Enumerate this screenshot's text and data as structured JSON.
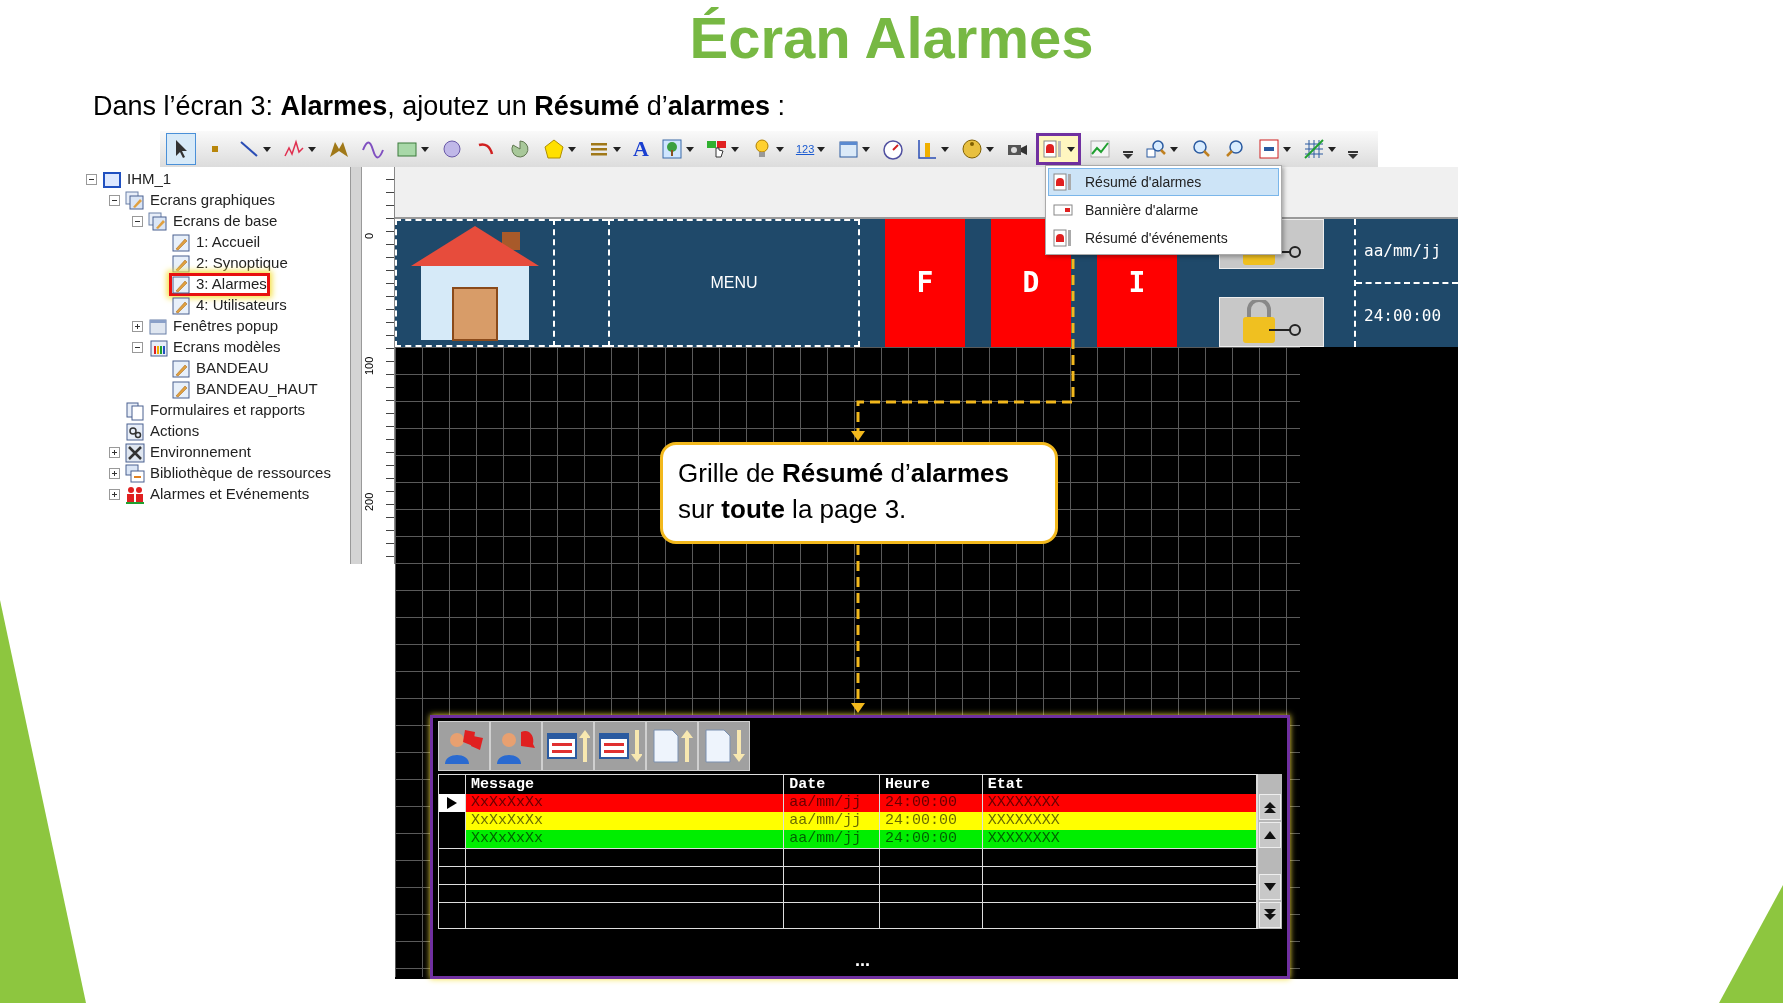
{
  "slide": {
    "title": "Écran Alarmes",
    "instruction": "Dans l’écran 3: **Alarmes**, ajoutez un **Résumé** d’**alarmes** :"
  },
  "toolbar": [
    {
      "kind": "pointer",
      "dropdown": false,
      "pressed": true,
      "highlighted": false
    },
    {
      "kind": "point",
      "dropdown": false,
      "pressed": false,
      "highlighted": false
    },
    {
      "kind": "line",
      "dropdown": true,
      "pressed": false,
      "highlighted": false
    },
    {
      "kind": "polyline",
      "dropdown": true,
      "pressed": false,
      "highlighted": false
    },
    {
      "kind": "bowtie",
      "dropdown": false,
      "pressed": false,
      "highlighted": false
    },
    {
      "kind": "curve",
      "dropdown": false,
      "pressed": false,
      "highlighted": false
    },
    {
      "kind": "rectangle",
      "dropdown": true,
      "pressed": false,
      "highlighted": false
    },
    {
      "kind": "circle",
      "dropdown": false,
      "pressed": false,
      "highlighted": false
    },
    {
      "kind": "arc",
      "dropdown": false,
      "pressed": false,
      "highlighted": false
    },
    {
      "kind": "pie",
      "dropdown": false,
      "pressed": false,
      "highlighted": false
    },
    {
      "kind": "pentagon",
      "dropdown": true,
      "pressed": false,
      "highlighted": false
    },
    {
      "kind": "lines",
      "dropdown": true,
      "pressed": false,
      "highlighted": false
    },
    {
      "kind": "text",
      "label": "A",
      "dropdown": false,
      "pressed": false,
      "highlighted": false
    },
    {
      "kind": "image",
      "dropdown": true,
      "pressed": false,
      "highlighted": false
    },
    {
      "kind": "switch",
      "dropdown": true,
      "pressed": false,
      "highlighted": false
    },
    {
      "kind": "bulb",
      "dropdown": true,
      "pressed": false,
      "highlighted": false
    },
    {
      "kind": "numeric",
      "label": "123",
      "dropdown": true,
      "pressed": false,
      "highlighted": false
    },
    {
      "kind": "window",
      "dropdown": true,
      "pressed": false,
      "highlighted": false
    },
    {
      "kind": "gauge",
      "dropdown": false,
      "pressed": false,
      "highlighted": false
    },
    {
      "kind": "barchart",
      "dropdown": true,
      "pressed": false,
      "highlighted": false
    },
    {
      "kind": "knob",
      "dropdown": true,
      "pressed": false,
      "highlighted": false
    },
    {
      "kind": "camera",
      "dropdown": false,
      "pressed": false,
      "highlighted": false
    },
    {
      "kind": "alarm",
      "dropdown": true,
      "pressed": true,
      "highlighted": true
    },
    {
      "kind": "trend",
      "dropdown": false,
      "pressed": false,
      "highlighted": false
    },
    {
      "kind": "overflow",
      "dropdown": false,
      "pressed": false,
      "highlighted": false
    },
    {
      "kind": "zoomin",
      "dropdown": true,
      "pressed": false,
      "highlighted": false
    },
    {
      "kind": "zoom",
      "dropdown": false,
      "pressed": false,
      "highlighted": false
    },
    {
      "kind": "zoomout",
      "dropdown": false,
      "pressed": false,
      "highlighted": false
    },
    {
      "kind": "fit",
      "dropdown": true,
      "pressed": false,
      "highlighted": false
    },
    {
      "kind": "grid",
      "dropdown": true,
      "pressed": false,
      "highlighted": false
    },
    {
      "kind": "overflow",
      "dropdown": false,
      "pressed": false,
      "highlighted": false
    }
  ],
  "tree": [
    {
      "label": "IHM_1",
      "kind": "project",
      "expanded": true,
      "selected": false,
      "children": [
        {
          "label": "Ecrans graphiques",
          "kind": "folder",
          "expanded": true,
          "selected": false,
          "children": [
            {
              "label": "Ecrans de base",
              "kind": "folder",
              "expanded": true,
              "selected": false,
              "children": [
                {
                  "label": "1: Accueil",
                  "kind": "screen",
                  "selected": false
                },
                {
                  "label": "2: Synoptique",
                  "kind": "screen",
                  "selected": false
                },
                {
                  "label": "3: Alarmes",
                  "kind": "screen",
                  "selected": true
                },
                {
                  "label": "4: Utilisateurs",
                  "kind": "screen",
                  "selected": false
                }
              ]
            },
            {
              "label": "Fenêtres popup",
              "kind": "popup",
              "expanded": false,
              "selected": false
            },
            {
              "label": "Ecrans modèles",
              "kind": "templates",
              "expanded": true,
              "selected": false,
              "children": [
                {
                  "label": "BANDEAU",
                  "kind": "screen",
                  "selected": false
                },
                {
                  "label": "BANDEAU_HAUT",
                  "kind": "screen",
                  "selected": false
                }
              ]
            }
          ]
        },
        {
          "label": "Formulaires et rapports",
          "kind": "forms",
          "selected": false
        },
        {
          "label": "Actions",
          "kind": "actions",
          "selected": false
        },
        {
          "label": "Environnement",
          "kind": "environment",
          "expanded": false,
          "selected": false
        },
        {
          "label": "Bibliothèque de ressources",
          "kind": "library",
          "expanded": false,
          "selected": false
        },
        {
          "label": "Alarmes et Evénements",
          "kind": "alarms",
          "expanded": false,
          "selected": false
        }
      ]
    }
  ],
  "ruler": [
    "0",
    "100",
    "200"
  ],
  "banner": {
    "menu": "MENU",
    "buttons": [
      "F",
      "D",
      "I"
    ],
    "date": "aa/mm/jj",
    "time": "24:00:00"
  },
  "dropdown_menu": [
    {
      "label": "Résumé d'alarmes",
      "kind": "summary",
      "selected": true
    },
    {
      "label": "Bannière d'alarme",
      "kind": "banner",
      "selected": false
    },
    {
      "label": "Résumé d'événements",
      "kind": "summary",
      "selected": false
    }
  ],
  "callout": "Grille de **Résumé** d’**alarmes** sur **toute** la page 3.",
  "alarm_summary": {
    "columns": [
      "Message",
      "Date",
      "Heure",
      "Etat"
    ],
    "rows": [
      {
        "selected": true,
        "color": "#ff0000",
        "cells": [
          "XxXxXxXx",
          "aa/mm/jj",
          "24:00:00",
          "XXXXXXXX"
        ]
      },
      {
        "selected": false,
        "color": "#ffff00",
        "cells": [
          "XxXxXxXx",
          "aa/mm/jj",
          "24:00:00",
          "XXXXXXXX"
        ]
      },
      {
        "selected": false,
        "color": "#00ee00",
        "cells": [
          "XxXxXxXx",
          "aa/mm/jj",
          "24:00:00",
          "XXXXXXXX"
        ]
      }
    ],
    "footer": "..."
  }
}
